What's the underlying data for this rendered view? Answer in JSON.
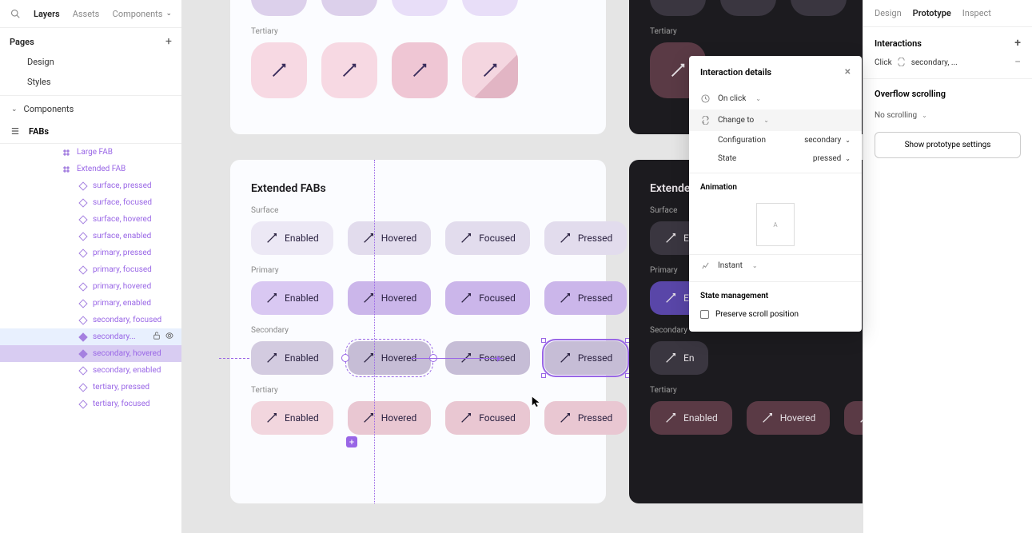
{
  "left": {
    "tabs": [
      "Layers",
      "Assets"
    ],
    "components_label": "Components",
    "pages_label": "Pages",
    "pages": [
      "Design",
      "Styles"
    ],
    "components_page": "Components",
    "fabs_label": "FABs",
    "parent_layers": [
      "Large FAB",
      "Extended FAB"
    ],
    "child_layers": [
      "surface, pressed",
      "surface, focused",
      "surface, hovered",
      "surface, enabled",
      "primary, pressed",
      "primary, focused",
      "primary, hovered",
      "primary, enabled",
      "secondary, focused",
      "secondary...",
      "secondary, hovered",
      "secondary, enabled",
      "tertiary, pressed",
      "tertiary, focused"
    ]
  },
  "canvas": {
    "tertiary_label": "Tertiary",
    "ext_title": "Extended FABs",
    "rows": [
      "Surface",
      "Primary",
      "Secondary",
      "Tertiary"
    ],
    "states": [
      "Enabled",
      "Hovered",
      "Focused",
      "Pressed"
    ]
  },
  "popover": {
    "title": "Interaction details",
    "trigger": "On click",
    "action": "Change to",
    "config_k": "Configuration",
    "config_v": "secondary",
    "state_k": "State",
    "state_v": "pressed",
    "animation": "Animation",
    "anim_a": "A",
    "easing": "Instant",
    "state_mgmt": "State management",
    "preserve": "Preserve scroll position"
  },
  "right": {
    "tabs": [
      "Design",
      "Prototype",
      "Inspect"
    ],
    "interactions": "Interactions",
    "click_label": "Click",
    "click_target": "secondary, ...",
    "overflow": "Overflow scrolling",
    "no_scroll": "No scrolling",
    "proto_btn": "Show prototype settings"
  }
}
